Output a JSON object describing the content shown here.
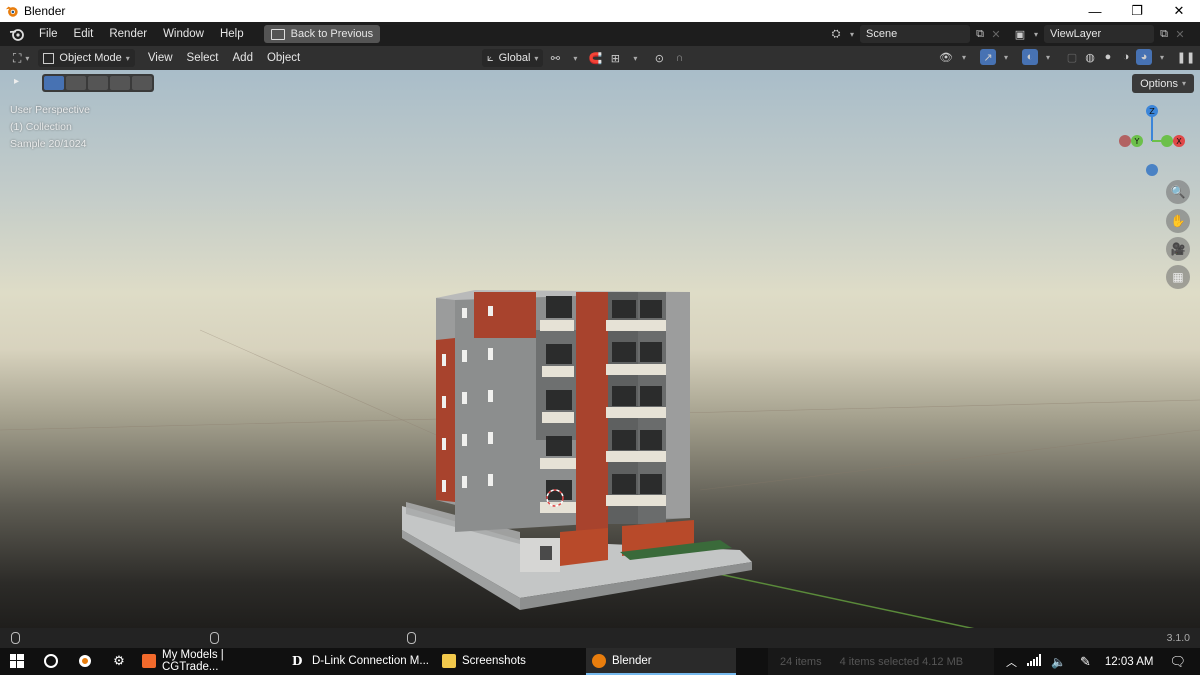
{
  "window": {
    "title": "Blender",
    "minimize": "—",
    "restore": "❐",
    "close": "✕"
  },
  "menu": {
    "items": [
      "File",
      "Edit",
      "Render",
      "Window",
      "Help"
    ],
    "back_button": "Back to Previous",
    "scene": "Scene",
    "view_layer": "ViewLayer"
  },
  "header3d": {
    "mode": "Object Mode",
    "items": [
      "View",
      "Select",
      "Add",
      "Object"
    ],
    "transform_orientation": "Global"
  },
  "viewport": {
    "perspective": "User Perspective",
    "collection": "(1) Collection",
    "sample": "Sample 20/1024",
    "options_label": "Options",
    "gizmo": {
      "z": "Z",
      "y": "Y",
      "x": "X"
    }
  },
  "statusbar": {
    "version": "3.1.0"
  },
  "taskbar": {
    "apps": [
      {
        "label": "My Models | CGTrade...",
        "icon": "brave-icon",
        "color": "#f26a2c"
      },
      {
        "label": "D-Link Connection M...",
        "icon": "dlink-icon",
        "color": "#ffffff"
      },
      {
        "label": "Screenshots",
        "icon": "folder-icon",
        "color": "#f2c94c"
      },
      {
        "label": "Blender",
        "icon": "blender-icon",
        "color": "#e87d0d"
      }
    ],
    "ghost_status": {
      "items": "24 items",
      "selected": "4 items selected  4.12 MB"
    },
    "time": "12:03 AM"
  },
  "colors": {
    "accent": "#4772b3",
    "x_axis": "#e04848",
    "y_axis": "#6cc04a",
    "z_axis": "#3b85d9"
  }
}
